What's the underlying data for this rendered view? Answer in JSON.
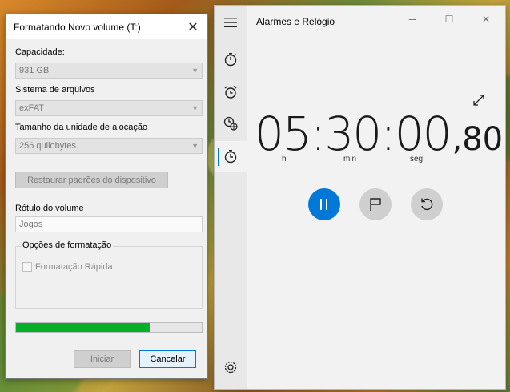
{
  "format_dialog": {
    "title": "Formatando Novo volume (T:)",
    "capacity_label": "Capacidade:",
    "capacity_value": "931 GB",
    "filesystem_label": "Sistema de arquivos",
    "filesystem_value": "exFAT",
    "alloc_label": "Tamanho da unidade de alocação",
    "alloc_value": "256 quilobytes",
    "restore_button": "Restaurar padrões do dispositivo",
    "volume_label_label": "Rótulo do volume",
    "volume_label_value": "Jogos",
    "options_group": "Opções de formatação",
    "quick_format": "Formatação Rápida",
    "progress_fraction": 0.72,
    "start_button": "Iniciar",
    "cancel_button": "Cancelar"
  },
  "clock_app": {
    "title": "Alarmes e Relógio",
    "time_main": "05:30:00",
    "time_fraction": ",80",
    "unit_h": "h",
    "unit_min": "min",
    "unit_seg": "seg",
    "accent": "#0078d7"
  }
}
